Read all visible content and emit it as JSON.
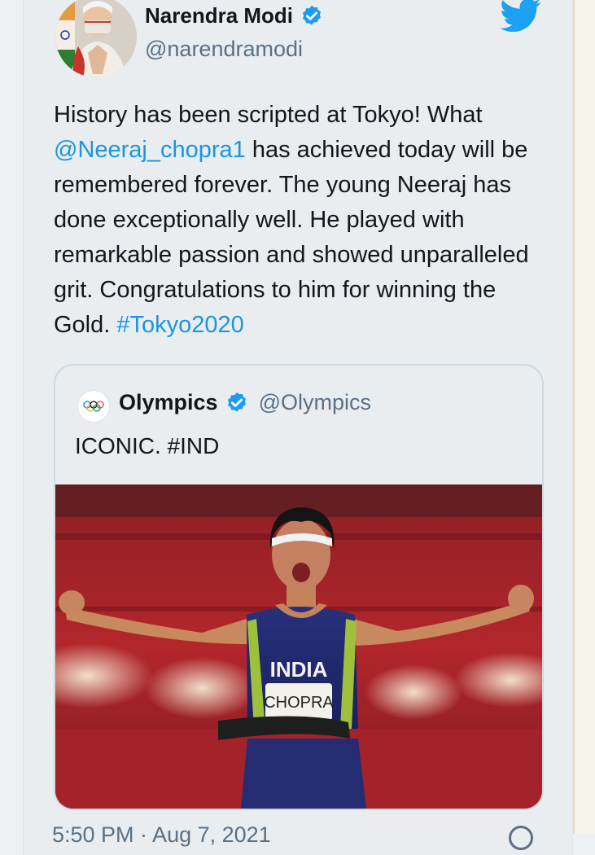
{
  "tweet": {
    "author": {
      "name": "Narendra Modi",
      "handle": "@narendramodi",
      "verified": true
    },
    "text_parts": {
      "part1": "History has been scripted at Tokyo! What ",
      "mention": "@Neeraj_chopra1",
      "part2": " has achieved today will be remembered forever. The young Neeraj has done exceptionally well. He played with remarkable passion and showed unparalleled grit. Congratulations to him for winning the Gold. ",
      "hashtag": "#Tokyo2020"
    },
    "footer": "5:50 PM · Aug 7, 2021"
  },
  "quoted_tweet": {
    "author": {
      "name": "Olympics",
      "handle": "@Olympics",
      "verified": true
    },
    "text": "ICONIC. #IND",
    "photo": {
      "jersey_text": "INDIA",
      "bib_text": "CHOPRA"
    }
  },
  "colors": {
    "link": "#1b95e0",
    "verified": "#1d9bf0",
    "text": "#14171a",
    "muted": "#5b7083",
    "background": "#e9edf0"
  },
  "icons": {
    "brand": "twitter-bird-icon",
    "verified": "verified-badge-icon",
    "info": "info-icon"
  }
}
